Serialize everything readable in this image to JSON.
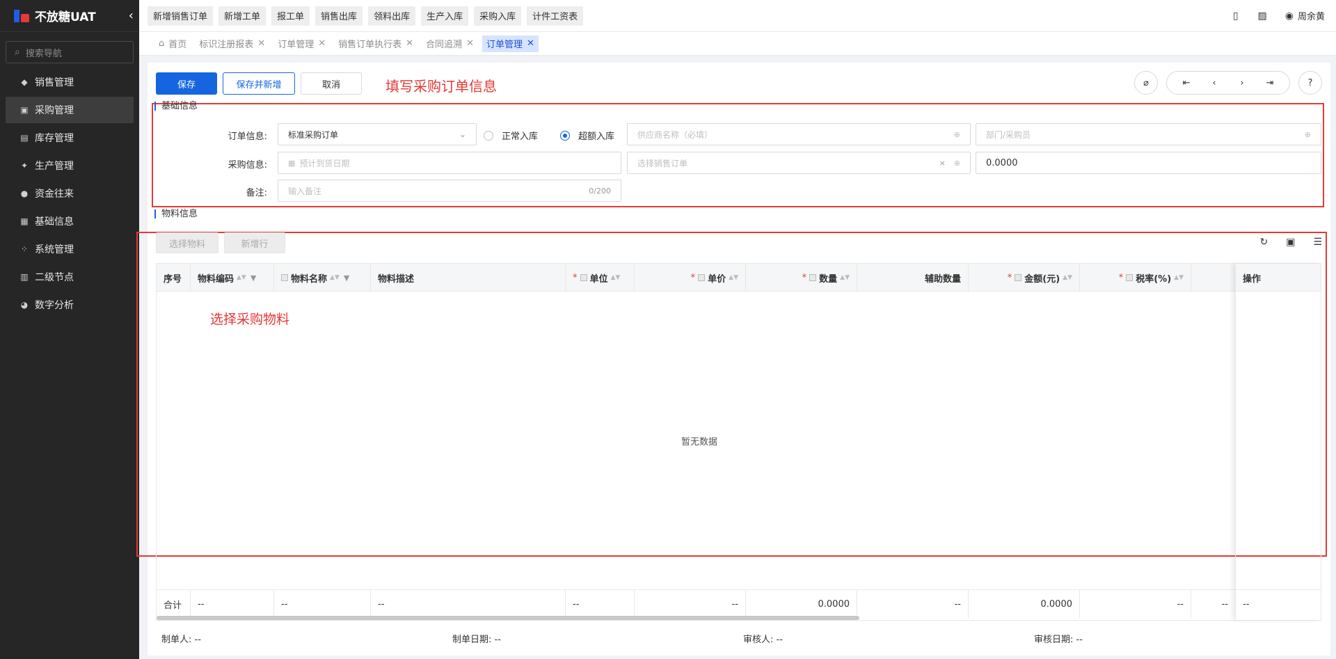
{
  "brand": {
    "title": "不放糖UAT"
  },
  "nav": {
    "search_placeholder": "搜索导航",
    "items": [
      {
        "label": "销售管理",
        "icon": "tag-icon"
      },
      {
        "label": "采购管理",
        "icon": "cart-icon"
      },
      {
        "label": "库存管理",
        "icon": "inventory-icon"
      },
      {
        "label": "生产管理",
        "icon": "production-icon"
      },
      {
        "label": "资金往来",
        "icon": "money-icon"
      },
      {
        "label": "基础信息",
        "icon": "grid-icon"
      },
      {
        "label": "系统管理",
        "icon": "settings-icon"
      },
      {
        "label": "二级节点",
        "icon": "document-icon"
      },
      {
        "label": "数字分析",
        "icon": "pie-chart-icon"
      }
    ]
  },
  "topbar": {
    "quick_buttons": [
      "新增销售订单",
      "新增工单",
      "报工单",
      "销售出库",
      "领料出库",
      "生产入库",
      "采购入库",
      "计件工资表"
    ],
    "user": "周余黄"
  },
  "tabs": [
    {
      "label": "首页"
    },
    {
      "label": "标识注册报表"
    },
    {
      "label": "订单管理"
    },
    {
      "label": "销售订单执行表"
    },
    {
      "label": "合同追溯"
    },
    {
      "label": "订单管理"
    }
  ],
  "actions": {
    "save": "保存",
    "save_new": "保存并新增",
    "cancel": "取消"
  },
  "annotations": {
    "fill_info": "填写采购订单信息",
    "select_material": "选择采购物料"
  },
  "form": {
    "section_title": "基础信息",
    "order_label": "订单信息:",
    "order_type": "标准采购订单",
    "radio_normal": "正常入库",
    "radio_over": "超额入库",
    "supplier_placeholder": "供应商名称（必填）",
    "dept_placeholder": "部门/采购员",
    "purchase_label": "采购信息:",
    "date_placeholder": "预计到货日期",
    "sales_order_placeholder": "选择销售订单",
    "amount_value": "0.0000",
    "remark_label": "备注:",
    "remark_placeholder": "输入备注",
    "remark_count": "0/200"
  },
  "materials": {
    "section_title": "物料信息",
    "select_btn": "选择物料",
    "add_row_btn": "新增行",
    "columns": [
      "序号",
      "物料编码",
      "物料名称",
      "物料描述",
      "单位",
      "单价",
      "数量",
      "辅助数量",
      "金额(元)",
      "税率(%)",
      "操作"
    ],
    "empty_text": "暂无数据",
    "footer": [
      "合计",
      "--",
      "--",
      "--",
      "--",
      "--",
      "0.0000",
      "--",
      "0.0000",
      "--",
      "--",
      "--"
    ]
  },
  "footer_info": {
    "creator": "制单人: --",
    "create_date": "制单日期: --",
    "reviewer": "审核人: --",
    "review_date": "审核日期: --"
  },
  "colors": {
    "primary": "#1565e0",
    "annotation": "#e53935",
    "sidebar": "#262626"
  }
}
